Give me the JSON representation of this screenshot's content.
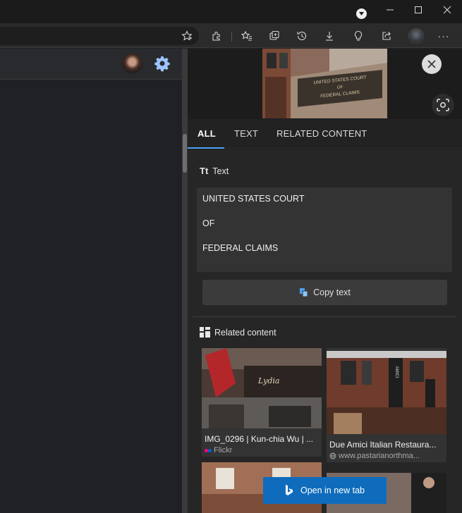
{
  "window": {
    "controls": [
      "minimize-icon",
      "maximize-icon",
      "close-icon"
    ]
  },
  "toolbar": {
    "icons": [
      "favorite-star-icon",
      "extensions-icon",
      "favorites-icon",
      "collections-icon",
      "history-icon",
      "downloads-icon",
      "lightbulb-icon",
      "share-icon",
      "more-icon"
    ],
    "more_label": "···"
  },
  "panel": {
    "tabs": [
      {
        "label": "ALL",
        "active": true
      },
      {
        "label": "TEXT",
        "active": false
      },
      {
        "label": "RELATED CONTENT",
        "active": false
      }
    ],
    "preview_sign": {
      "line1": "UNITED STATES COURT",
      "line2": "OF",
      "line3": "FEDERAL CLAIMS"
    },
    "text_section": {
      "title_icon": "Tt",
      "title": "Text",
      "lines": [
        "UNITED STATES COURT",
        "OF",
        "FEDERAL CLAIMS"
      ],
      "copy_label": "Copy text"
    },
    "related_section": {
      "title": "Related content",
      "cards": [
        {
          "caption": "IMG_0296 | Kun-chia Wu | ...",
          "source": "Flickr"
        },
        {
          "caption": "Due Amici Italian Restaura...",
          "source": "www.pastarianorthma..."
        }
      ]
    },
    "open_new_tab_label": "Open in new tab"
  },
  "colors": {
    "accent": "#4ea1f5",
    "button_blue": "#0f6cbd",
    "panel_bg": "#1c1c1c"
  }
}
